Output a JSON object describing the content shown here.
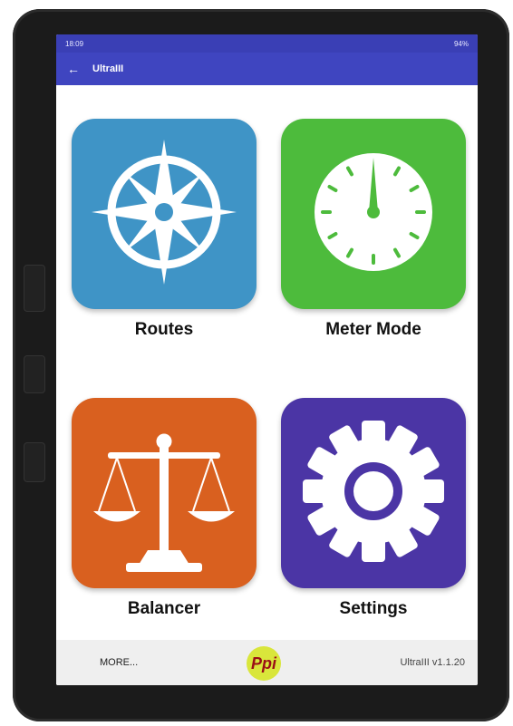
{
  "status_bar": {
    "time": "18:09",
    "battery": "94%"
  },
  "app_bar": {
    "title": "UltraIII",
    "back_icon": "arrow-left-icon"
  },
  "tiles": [
    {
      "label": "Routes",
      "icon": "compass-rose-icon",
      "color": "#3f94c6"
    },
    {
      "label": "Meter Mode",
      "icon": "gauge-dial-icon",
      "color": "#4dbb3c"
    },
    {
      "label": "Balancer",
      "icon": "balance-scale-icon",
      "color": "#d9601f"
    },
    {
      "label": "Settings",
      "icon": "gear-icon",
      "color": "#4b35a5"
    }
  ],
  "bottom_bar": {
    "more_label": "MORE...",
    "logo_text": "Ppi",
    "version": "UltraIII v1.1.20"
  }
}
